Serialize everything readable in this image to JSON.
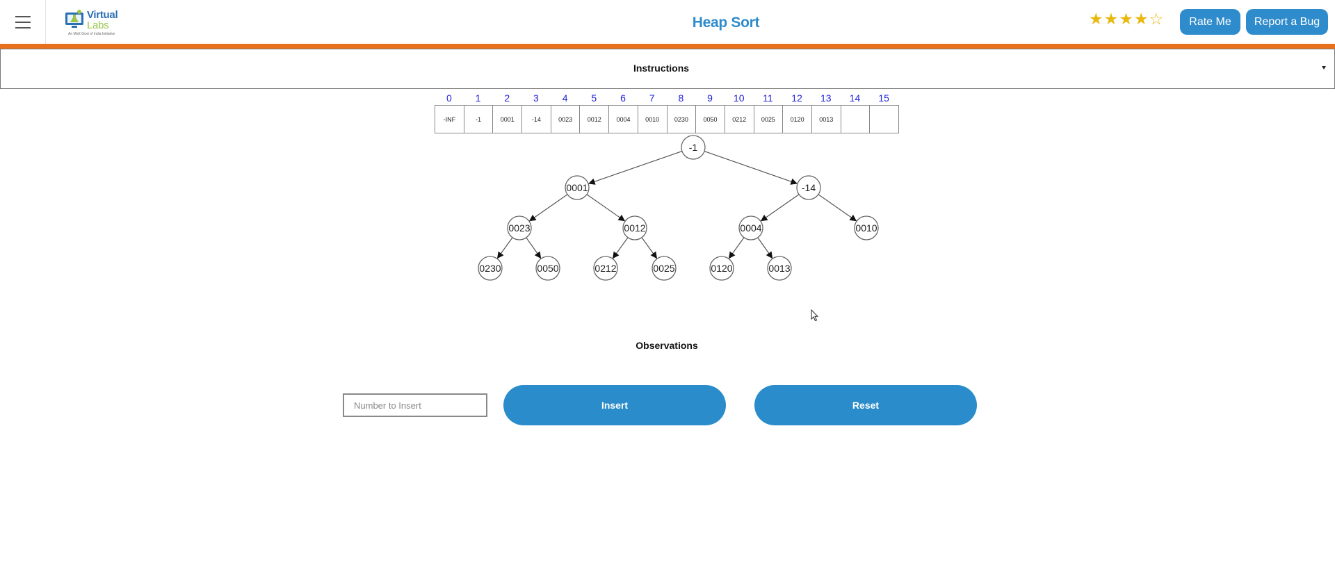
{
  "header": {
    "logo": {
      "line1": "Virtual",
      "line2": "Labs",
      "tagline": "An MoE Govt of India Initiative"
    },
    "title": "Heap Sort",
    "rating": {
      "filled": 4,
      "max": 5
    },
    "rate_label": "Rate Me",
    "bug_label": "Report a Bug"
  },
  "instructions": {
    "label": "Instructions"
  },
  "array": {
    "indices": [
      "0",
      "1",
      "2",
      "3",
      "4",
      "5",
      "6",
      "7",
      "8",
      "9",
      "10",
      "11",
      "12",
      "13",
      "14",
      "15"
    ],
    "values": [
      "-INF",
      "-1",
      "0001",
      "-14",
      "0023",
      "0012",
      "0004",
      "0010",
      "0230",
      "0050",
      "0212",
      "0025",
      "0120",
      "0013",
      "",
      ""
    ]
  },
  "tree": {
    "nodes": [
      "-1",
      "0001",
      "-14",
      "0023",
      "0012",
      "0004",
      "0010",
      "0230",
      "0050",
      "0212",
      "0025",
      "0120",
      "0013"
    ]
  },
  "observations": {
    "label": "Observations"
  },
  "controls": {
    "input_placeholder": "Number to Insert",
    "input_value": "",
    "insert_label": "Insert",
    "reset_label": "Reset"
  },
  "colors": {
    "accent": "#2f8ccc",
    "brand_bar": "#e8701c",
    "index_text": "#2222dd",
    "star": "#e8b80f"
  }
}
